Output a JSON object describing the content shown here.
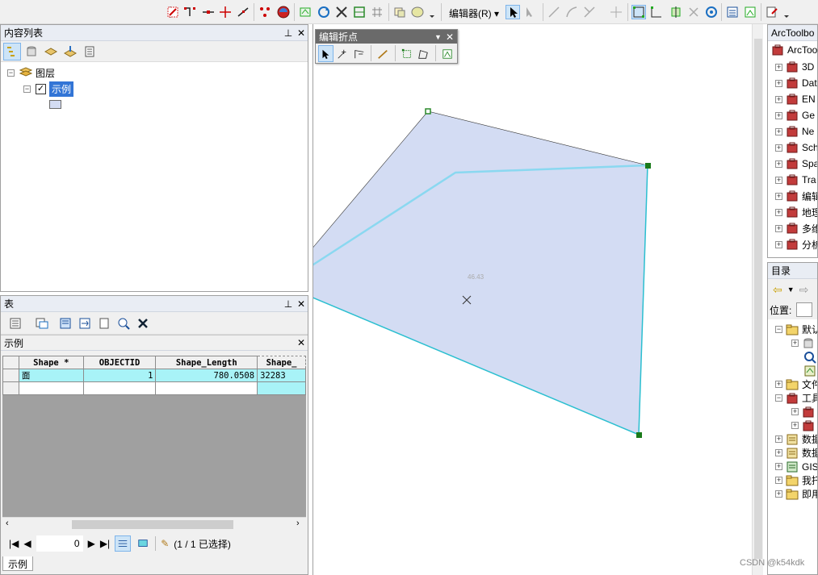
{
  "toolbar": {
    "editor_menu_label": "编辑器(R)"
  },
  "toc": {
    "title": "内容列表",
    "root_label": "图层",
    "layer_label": "示例"
  },
  "table_window": {
    "title": "表",
    "tab_title": "示例",
    "columns": [
      "Shape *",
      "OBJECTID",
      "Shape_Length",
      "Shape_"
    ],
    "rows": [
      [
        "面",
        "1",
        "780.0508",
        "32283"
      ],
      [
        "",
        "",
        "",
        ""
      ]
    ],
    "record_index": "0",
    "selection_status": "(1 / 1 已选择)",
    "bottom_tab": "示例"
  },
  "vertex_toolbar": {
    "title": "编辑折点"
  },
  "map": {
    "annotation": "46.43"
  },
  "arctoolbox": {
    "title": "ArcToolbo",
    "root_label": "ArcToo",
    "items": [
      "3D",
      "Dat",
      "EN",
      "Ge",
      "Ne",
      "Sch",
      "Spa",
      "Tra",
      "编辑",
      "地理",
      "多维",
      "分析"
    ]
  },
  "catalog": {
    "title": "目录",
    "location_label": "位置:",
    "items": [
      {
        "label": "默认",
        "indent": 0,
        "icon": "folder"
      },
      {
        "label": "",
        "indent": 1,
        "icon": "database"
      },
      {
        "label": "",
        "indent": 1,
        "icon": "search"
      },
      {
        "label": "",
        "indent": 1,
        "icon": "map"
      },
      {
        "label": "文件",
        "indent": 0,
        "icon": "folder"
      },
      {
        "label": "工具",
        "indent": 0,
        "icon": "toolbox"
      },
      {
        "label": "",
        "indent": 1,
        "icon": "toolbox"
      },
      {
        "label": "",
        "indent": 1,
        "icon": "toolbox"
      },
      {
        "label": "数据",
        "indent": 0,
        "icon": "db"
      },
      {
        "label": "数据",
        "indent": 0,
        "icon": "db"
      },
      {
        "label": "GIS",
        "indent": 0,
        "icon": "gis"
      },
      {
        "label": "我托",
        "indent": 0,
        "icon": "folder"
      },
      {
        "label": "即用",
        "indent": 0,
        "icon": "folder"
      }
    ]
  },
  "watermark": "CSDN @k54kdk"
}
